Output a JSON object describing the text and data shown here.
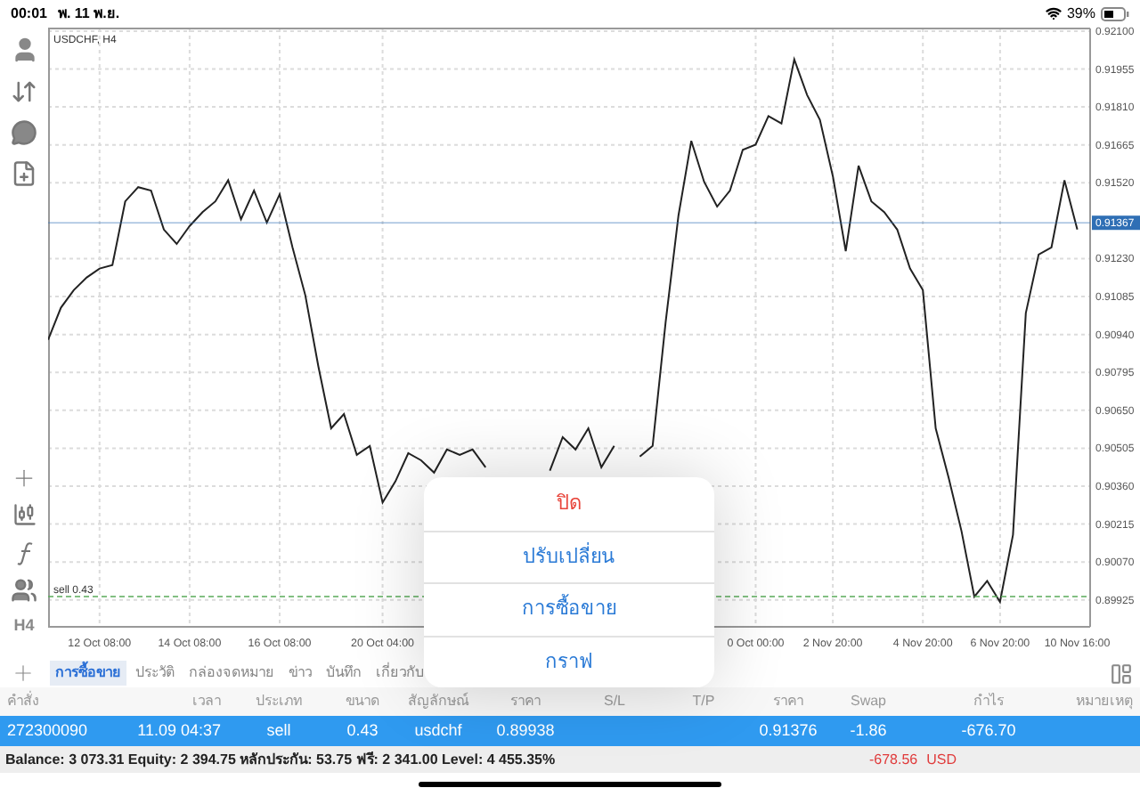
{
  "status_bar": {
    "time": "00:01",
    "date": "พ. 11 พ.ย.",
    "battery": "39%"
  },
  "toolbar": {
    "timeframe": "H4"
  },
  "chart": {
    "chart_data": {
      "type": "line",
      "title": "USDCHF, H4",
      "grid": true,
      "categories": [
        null,
        null,
        null,
        null,
        "12 Oct 08:00",
        null,
        null,
        null,
        null,
        null,
        null,
        "14 Oct 08:00",
        null,
        null,
        null,
        null,
        null,
        null,
        "16 Oct 08:00",
        null,
        null,
        null,
        null,
        null,
        null,
        null,
        "20 Oct 04:00",
        null,
        null,
        null,
        null,
        null,
        null,
        null,
        null,
        null,
        null,
        null,
        null,
        null,
        null,
        null,
        null,
        null,
        null,
        null,
        null,
        null,
        null,
        null,
        null,
        null,
        null,
        null,
        null,
        "0 Oct 00:00",
        null,
        null,
        null,
        null,
        null,
        "2 Nov 20:00",
        null,
        null,
        null,
        null,
        null,
        null,
        "4 Nov 20:00",
        null,
        null,
        null,
        null,
        null,
        "6 Nov 20:00",
        null,
        null,
        null,
        null,
        null,
        "10 Nov 16:00"
      ],
      "ylim": [
        0.89822,
        0.9211
      ],
      "series": [
        {
          "color": "#222222",
          "values": [
            0.9092,
            0.91042,
            0.9111,
            0.91158,
            0.91192,
            0.91205,
            0.91449,
            0.91503,
            0.9149,
            0.91341,
            0.91286,
            0.91354,
            0.91408,
            0.91449,
            0.9153,
            0.91381,
            0.9149,
            0.91368,
            0.91476,
            0.91273,
            0.9109,
            0.90819,
            0.90581,
            0.90636,
            0.9048,
            0.90514,
            0.90297,
            0.90378,
            0.90486,
            0.90459,
            0.90412,
            0.905,
            0.9048,
            0.905,
            0.90432,
            null,
            null,
            null,
            null,
            0.90419,
            0.90547,
            0.905,
            0.90581,
            0.90432,
            0.90514,
            null,
            0.90473,
            0.90514,
            0.90988,
            0.91395,
            0.9168,
            0.91524,
            0.91429,
            0.9149,
            0.91646,
            0.91666,
            0.91775,
            0.91747,
            0.91992,
            0.91856,
            0.91761,
            0.91544,
            0.91259,
            0.91585,
            0.91449,
            0.91408,
            0.91341,
            0.91192,
            0.9111,
            0.90581,
            0.90391,
            0.90188,
            0.89937,
            0.89998,
            0.89917,
            0.90174,
            0.91022,
            0.91246,
            0.91273,
            0.9153,
            0.91341
          ]
        }
      ],
      "yticks": [
        {
          "value": 0.921,
          "label": "0.92100"
        },
        {
          "value": 0.91955,
          "label": "0.91955"
        },
        {
          "value": 0.9181,
          "label": "0.91810"
        },
        {
          "value": 0.91665,
          "label": "0.91665"
        },
        {
          "value": 0.9152,
          "label": "0.91520"
        },
        {
          "value": 0.9123,
          "label": "0.91230"
        },
        {
          "value": 0.91085,
          "label": "0.91085"
        },
        {
          "value": 0.9094,
          "label": "0.90940"
        },
        {
          "value": 0.90795,
          "label": "0.90795"
        },
        {
          "value": 0.9065,
          "label": "0.90650"
        },
        {
          "value": 0.90505,
          "label": "0.90505"
        },
        {
          "value": 0.9036,
          "label": "0.90360"
        },
        {
          "value": 0.90215,
          "label": "0.90215"
        },
        {
          "value": 0.9007,
          "label": "0.90070"
        },
        {
          "value": 0.89925,
          "label": "0.89925"
        }
      ],
      "ref_lines": [
        {
          "axis": "y",
          "value": 0.91367,
          "label": "0.91367",
          "color": "#2f6fb5"
        },
        {
          "axis": "y",
          "value": 0.89938,
          "label": "sell 0.43",
          "color": "#5aaa5a"
        }
      ]
    }
  },
  "tabs": [
    {
      "label": "การซื้อขาย",
      "selected": true
    },
    {
      "label": "ประวัติ",
      "selected": false
    },
    {
      "label": "กล่องจดหมาย",
      "selected": false
    },
    {
      "label": "ข่าว",
      "selected": false
    },
    {
      "label": "บันทึก",
      "selected": false
    },
    {
      "label": "เกี่ยวกับ",
      "selected": false
    }
  ],
  "table": {
    "columns": [
      "คำสั่ง",
      "เวลา",
      "ประเภท",
      "ขนาด",
      "สัญลักษณ์",
      "ราคา",
      "S/L",
      "T/P",
      "ราคา",
      "Swap",
      "กำไร",
      "หมายเหตุ"
    ],
    "rows": [
      {
        "selected": true,
        "cells": [
          {
            "text": "272300090"
          },
          {
            "text": "11.09 04:37"
          },
          {
            "text": "sell"
          },
          {
            "text": "0.43"
          },
          {
            "text": "usdchf"
          },
          {
            "text": "0.89938"
          },
          {},
          {},
          {
            "text": "0.91376"
          },
          {
            "text": "-1.86"
          },
          {
            "text": "-676.70"
          },
          {}
        ]
      }
    ]
  },
  "summary": {
    "text": "Balance: 3 073.31 Equity: 2 394.75 หลักประกัน: 53.75 ฟรี: 2 341.00 Level: 4 455.35%",
    "total": "-678.56",
    "currency": "USD"
  },
  "popup_menu": {
    "items": [
      {
        "label": "ปิด",
        "kind": "destructive"
      },
      {
        "label": "ปรับเปลี่ยน",
        "kind": "default"
      },
      {
        "label": "การซื้อขาย",
        "kind": "default"
      },
      {
        "label": "กราฟ",
        "kind": "default"
      }
    ]
  }
}
